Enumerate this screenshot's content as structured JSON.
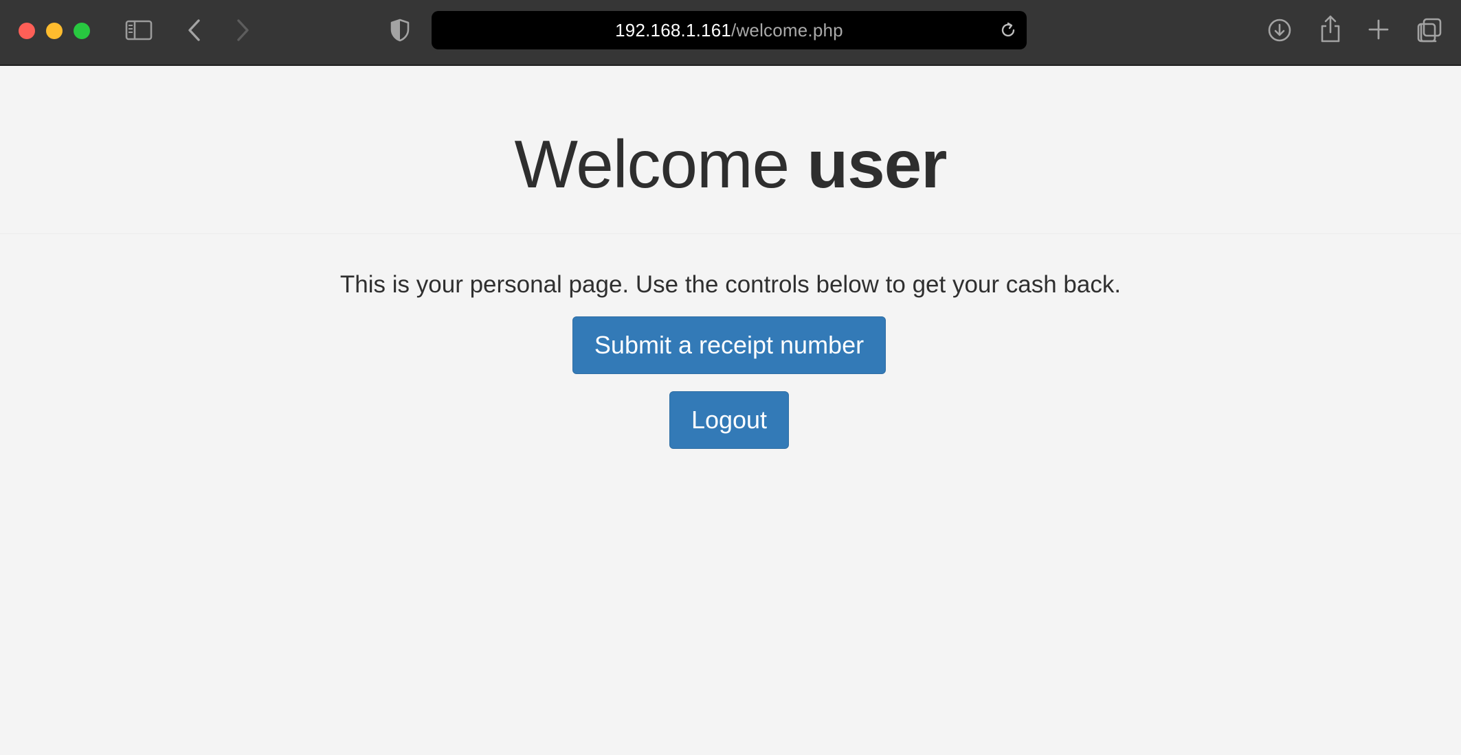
{
  "browser": {
    "url_host": "192.168.1.161",
    "url_path": "/welcome.php",
    "icons": {
      "sidebar": "sidebar-icon",
      "back": "chevron-left-icon",
      "forward": "chevron-right-icon",
      "privacy": "shield-icon",
      "reload": "reload-icon",
      "download": "download-icon",
      "share": "share-icon",
      "new_tab": "plus-icon",
      "tabs": "tabs-overview-icon"
    }
  },
  "page": {
    "title_prefix": "Welcome ",
    "title_user": "user",
    "intro": "This is your personal page. Use the controls below to get your cash back.",
    "submit_label": "Submit a receipt number",
    "logout_label": "Logout"
  },
  "colors": {
    "button": "#337ab7",
    "page_background": "#f4f4f4",
    "toolbar": "#363636"
  }
}
